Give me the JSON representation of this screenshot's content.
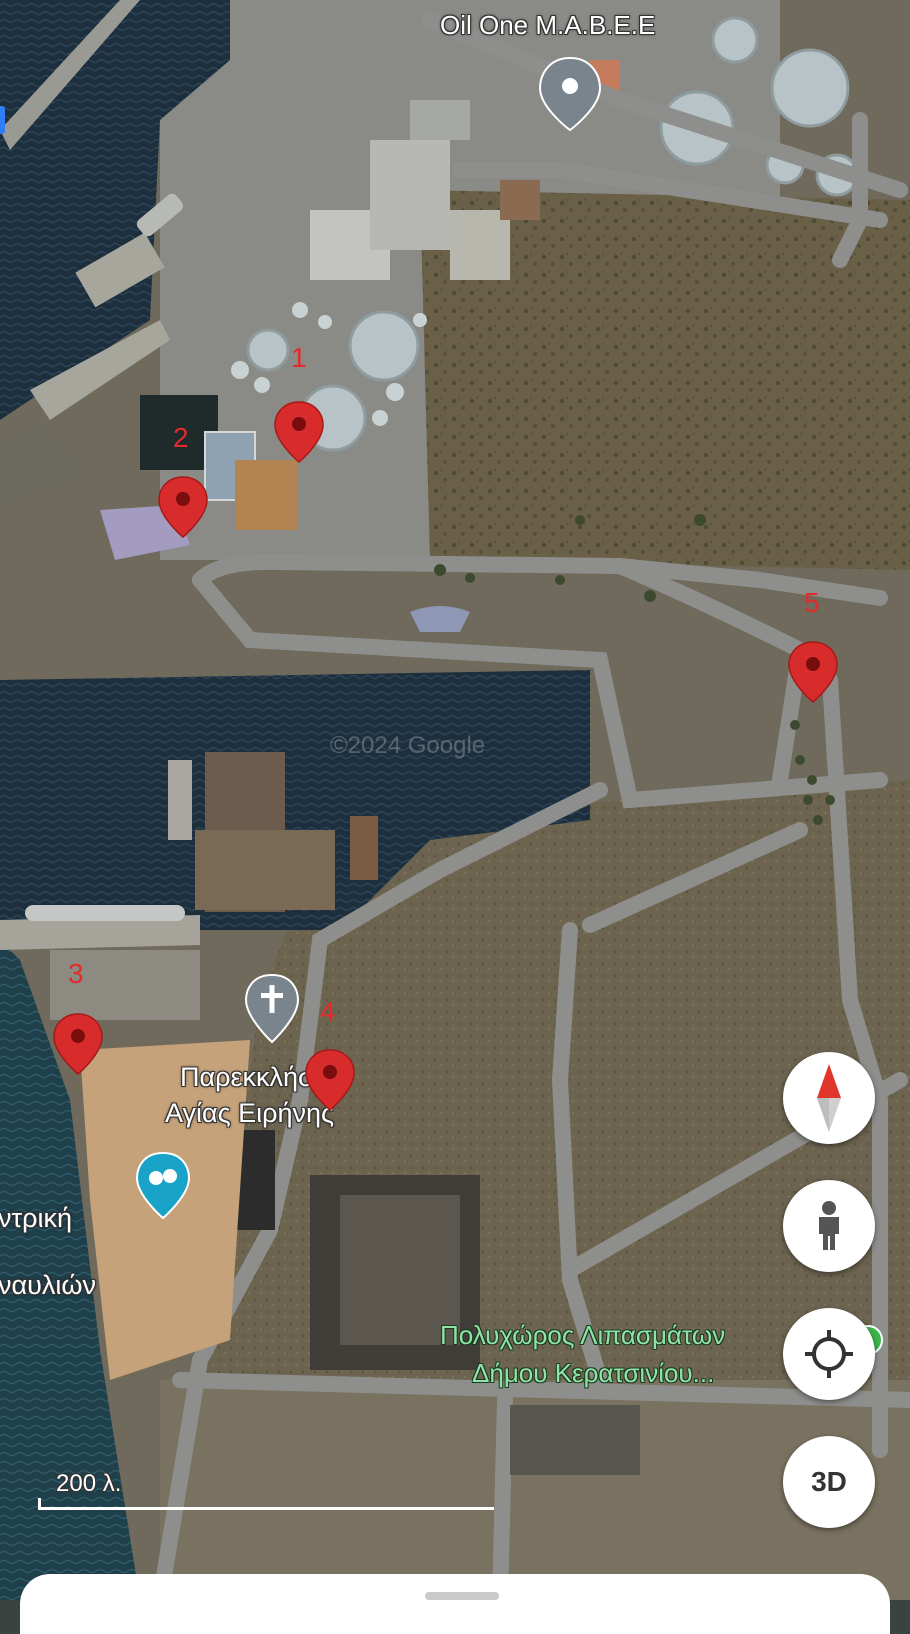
{
  "map": {
    "poi_labels": {
      "oil_one": "Oil One M.A.B.E.E",
      "church_line1": "Παρεκκλήσι",
      "church_line2": "Αγίας Ειρήνης",
      "partial_left_line1": "ντρική",
      "partial_left_line2": "ναυλιών",
      "venue_line1": "Πολυχώρος Λιπασμάτων",
      "venue_line2": "Δήμου Κερατσινίου..."
    },
    "watermark": "©2024 Google",
    "markers": [
      {
        "number": "1",
        "color": "#d82b2b"
      },
      {
        "number": "2",
        "color": "#d82b2b"
      },
      {
        "number": "3",
        "color": "#d82b2b"
      },
      {
        "number": "4",
        "color": "#d82b2b"
      },
      {
        "number": "5",
        "color": "#d82b2b"
      }
    ],
    "scale": "200 λ.",
    "icons": {
      "oil_one": "place-icon",
      "church": "church-icon",
      "theater": "theater-icon",
      "venue": "venue-icon"
    }
  },
  "controls": {
    "compass": "compass-icon",
    "pegman": "pegman-icon",
    "my_location": "my-location-icon",
    "three_d_label": "3D"
  },
  "colors": {
    "marker_red": "#d82b2b",
    "label_green": "#8fe3a4",
    "church_pin": "#7a848c",
    "theater_pin": "#1aa3c8"
  }
}
